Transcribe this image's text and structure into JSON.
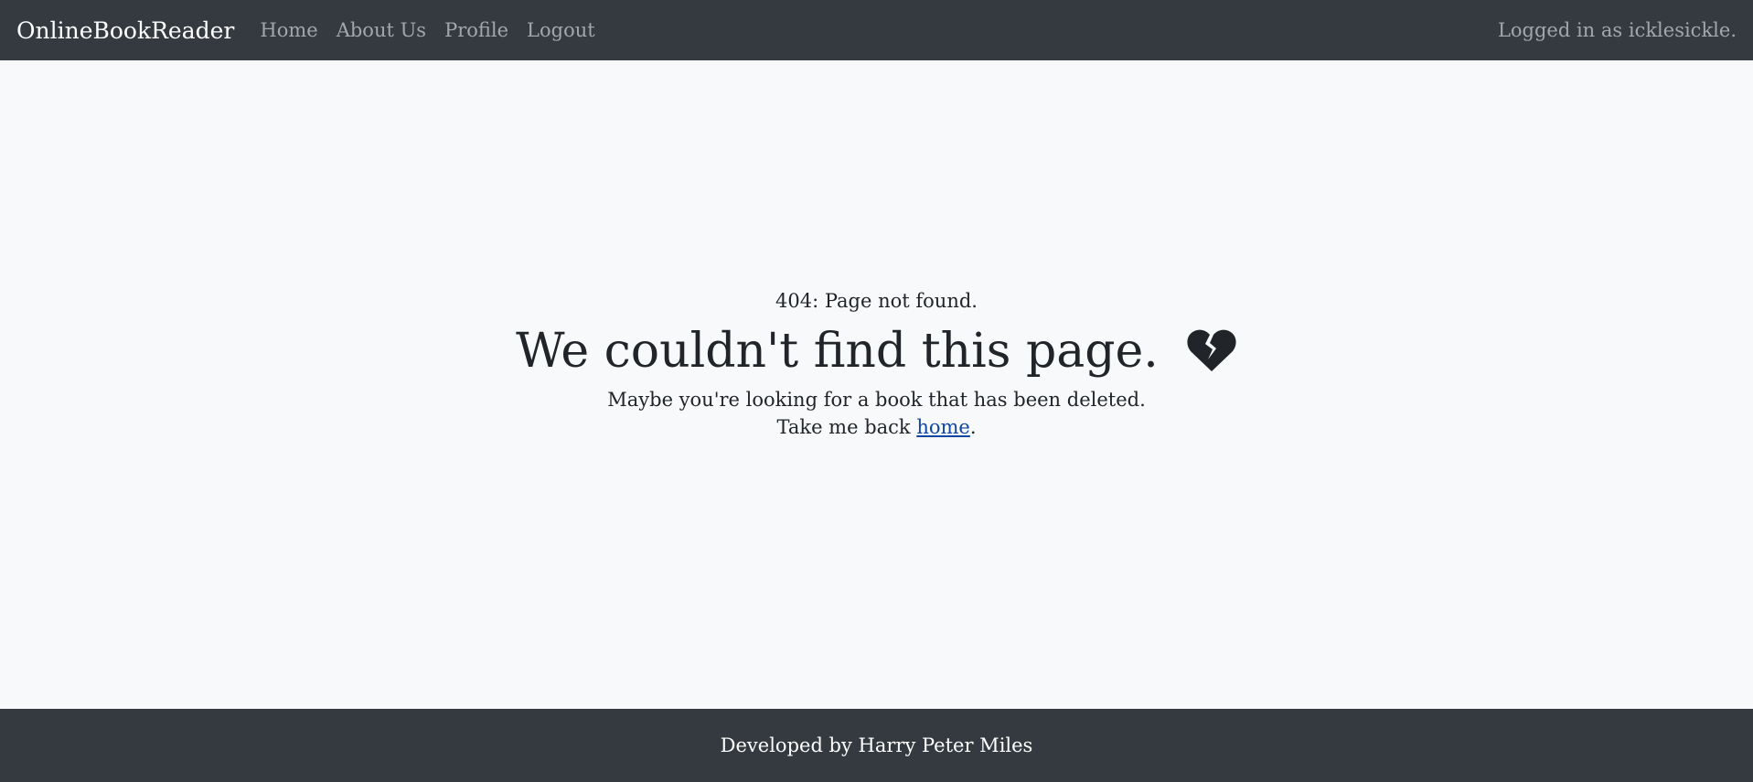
{
  "navbar": {
    "brand": "OnlineBookReader",
    "links": [
      {
        "label": "Home"
      },
      {
        "label": "About Us"
      },
      {
        "label": "Profile"
      },
      {
        "label": "Logout"
      }
    ],
    "logged_in_text": "Logged in as icklesickle."
  },
  "error": {
    "status": "404: Page not found.",
    "headline": "We couldn't find this page.",
    "icon": "heart-broken-icon",
    "message": "Maybe you're looking for a book that has been deleted.",
    "back_prefix": "Take me back ",
    "back_link": "home",
    "back_suffix": "."
  },
  "footer": {
    "text": "Developed by Harry Peter Miles"
  },
  "colors": {
    "navbar_bg": "#343a40",
    "page_bg": "#f8f9fa",
    "text": "#212529",
    "link": "#0d47a1"
  }
}
